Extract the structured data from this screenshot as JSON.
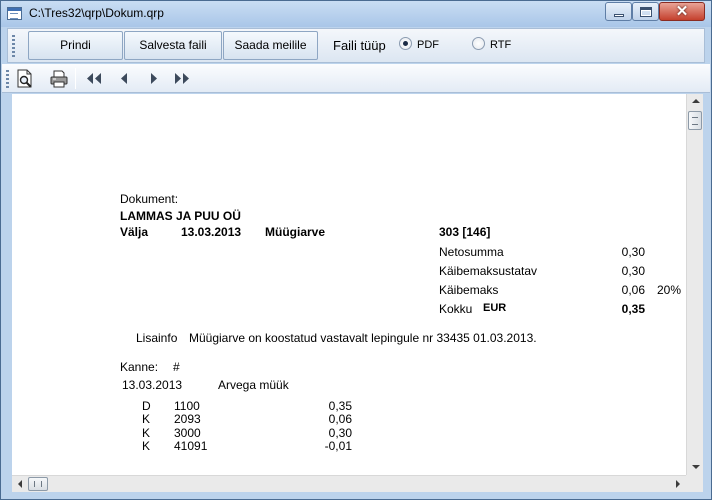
{
  "window": {
    "title": "C:\\Tres32\\qrp\\Dokum.qrp"
  },
  "toolbar": {
    "print_label": "Prindi",
    "save_label": "Salvesta faili",
    "mail_label": "Saada meilile",
    "file_type_label": "Faili tüüp",
    "pdf_label": "PDF",
    "rtf_label": "RTF",
    "selected_type": "PDF"
  },
  "nav_icons": [
    "preview-icon",
    "printer-icon",
    "first-page-icon",
    "previous-page-icon",
    "next-page-icon",
    "last-page-icon"
  ],
  "document": {
    "heading": "Dokument:",
    "company": "LAMMAS JA PUU OÜ",
    "direction": "Välja",
    "date": "13.03.2013",
    "doc_type": "Müügiarve",
    "number": "303 [146]",
    "totals": [
      {
        "label": "Netosumma",
        "value": "0,30",
        "extra": ""
      },
      {
        "label": "Käibemaksustatav",
        "value": "0,30",
        "extra": ""
      },
      {
        "label": "Käibemaks",
        "value": "0,06",
        "extra": "20%"
      }
    ],
    "total_label": "Kokku",
    "currency": "EUR",
    "total_value": "0,35",
    "info_label": "Lisainfo",
    "info_text": "Müügiarve on koostatud vastavalt lepingule nr 33435 01.03.2013.",
    "entry_label": "Kanne:",
    "entry_number": "#",
    "entry_date": "13.03.2013",
    "entry_desc": "Arvega müük",
    "entries": [
      {
        "side": "D",
        "account": "1100",
        "amount": "0,35"
      },
      {
        "side": "K",
        "account": "2093",
        "amount": "0,06"
      },
      {
        "side": "K",
        "account": "3000",
        "amount": "0,30"
      },
      {
        "side": "K",
        "account": "41091",
        "amount": "-0,01"
      }
    ]
  }
}
